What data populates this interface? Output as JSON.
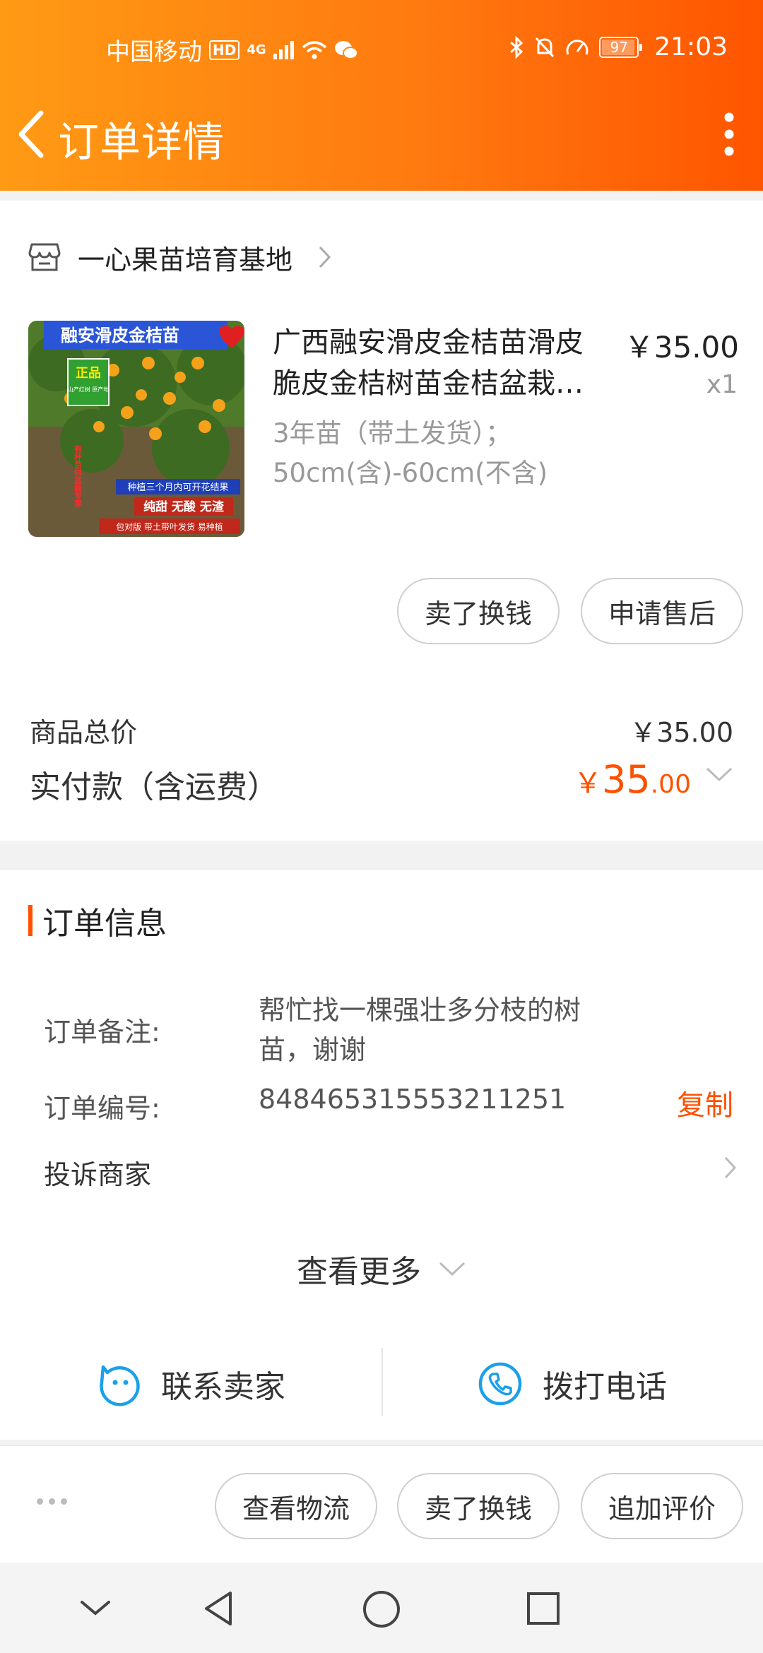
{
  "status_bar": {
    "carrier": "中国移动",
    "hd": "HD",
    "network": "4G",
    "battery": "97",
    "time": "21:03"
  },
  "header": {
    "title": "订单详情"
  },
  "shop": {
    "name": "一心果苗培育基地"
  },
  "product": {
    "image_text": {
      "banner": "融安滑皮金桔苗",
      "badge": "正品",
      "badge_sub": "山产红树 原产地",
      "side": "有杯苗供盆栽专享",
      "tagline": "种植三个月内可开花结果",
      "features": "纯甜 无酸 无渣",
      "shipping": "包对版 带土带叶发货 易种植"
    },
    "title": "广西融安滑皮金桔苗滑皮脆皮金桔树苗金桔盆栽地栽",
    "spec": "3年苗（带土发货）；50cm(含)-60cm(不含)",
    "price": "￥35.00",
    "qty": "x1"
  },
  "product_buttons": {
    "sell": "卖了换钱",
    "after_sale": "申请售后"
  },
  "summary": {
    "total_label": "商品总价",
    "total_value": "￥35.00",
    "paid_label": "实付款（含运费）",
    "paid_symbol": "￥",
    "paid_int": "35",
    "paid_dec": ".00"
  },
  "order_info": {
    "title": "订单信息",
    "note_label": "订单备注:",
    "note_value": "帮忙找一棵强壮多分枝的树苗，谢谢",
    "no_label": "订单编号:",
    "no_value": "848465315553211251",
    "copy_label": "复制",
    "complain_label": "投诉商家",
    "see_more": "查看更多"
  },
  "contact": {
    "seller": "联系卖家",
    "phone": "拨打电话"
  },
  "action_bar": {
    "logistics": "查看物流",
    "sell": "卖了换钱",
    "review": "追加评价"
  },
  "colors": {
    "accent": "#ff5000",
    "header_start": "#ff9a14",
    "header_end": "#ff5500",
    "contact_icon": "#1aa0e8"
  }
}
